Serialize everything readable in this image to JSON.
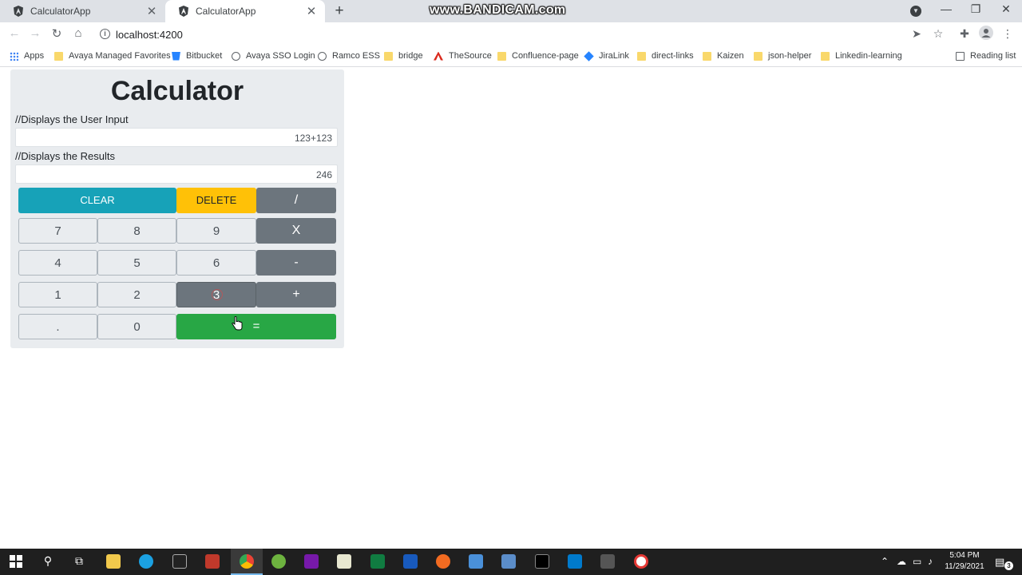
{
  "browser": {
    "tabs": [
      {
        "title": "CalculatorApp",
        "active": false
      },
      {
        "title": "CalculatorApp",
        "active": true
      }
    ],
    "watermark": "www.BANDICAM.com",
    "url": "localhost:4200",
    "bookmarks": [
      {
        "label": "Apps",
        "icon": "apps-grid-icon"
      },
      {
        "label": "Avaya Managed Favorites",
        "icon": "folder-icon"
      },
      {
        "label": "Bitbucket",
        "icon": "bitbucket-icon"
      },
      {
        "label": "Avaya SSO Login",
        "icon": "globe-icon"
      },
      {
        "label": "Ramco ESS",
        "icon": "globe-icon"
      },
      {
        "label": "bridge",
        "icon": "folder-icon"
      },
      {
        "label": "TheSource",
        "icon": "avaya-icon"
      },
      {
        "label": "Confluence-page",
        "icon": "folder-icon"
      },
      {
        "label": "JiraLink",
        "icon": "jira-icon"
      },
      {
        "label": "direct-links",
        "icon": "folder-icon"
      },
      {
        "label": "Kaizen",
        "icon": "folder-icon"
      },
      {
        "label": "json-helper",
        "icon": "folder-icon"
      },
      {
        "label": "Linkedin-learning",
        "icon": "folder-icon"
      }
    ],
    "reading_list": "Reading list"
  },
  "calculator": {
    "title": "Calculator",
    "input_label": "//Displays the User Input",
    "input_value": "123+123",
    "result_label": "//Displays the Results",
    "result_value": "246",
    "keys": {
      "clear": "CLEAR",
      "delete": "DELETE",
      "divide": "/",
      "seven": "7",
      "eight": "8",
      "nine": "9",
      "multiply": "X",
      "four": "4",
      "five": "5",
      "six": "6",
      "minus": "-",
      "one": "1",
      "two": "2",
      "three": "3",
      "plus": "+",
      "dot": ".",
      "zero": "0",
      "equals": "="
    },
    "pressed_key": "3",
    "colors": {
      "panel": "#e9ecef",
      "clear": "#17a2b8",
      "delete": "#ffc107",
      "operator": "#6c757d",
      "equals": "#28a745"
    }
  },
  "taskbar": {
    "time": "5:04 PM",
    "date": "11/29/2021",
    "notification_count": "3"
  }
}
